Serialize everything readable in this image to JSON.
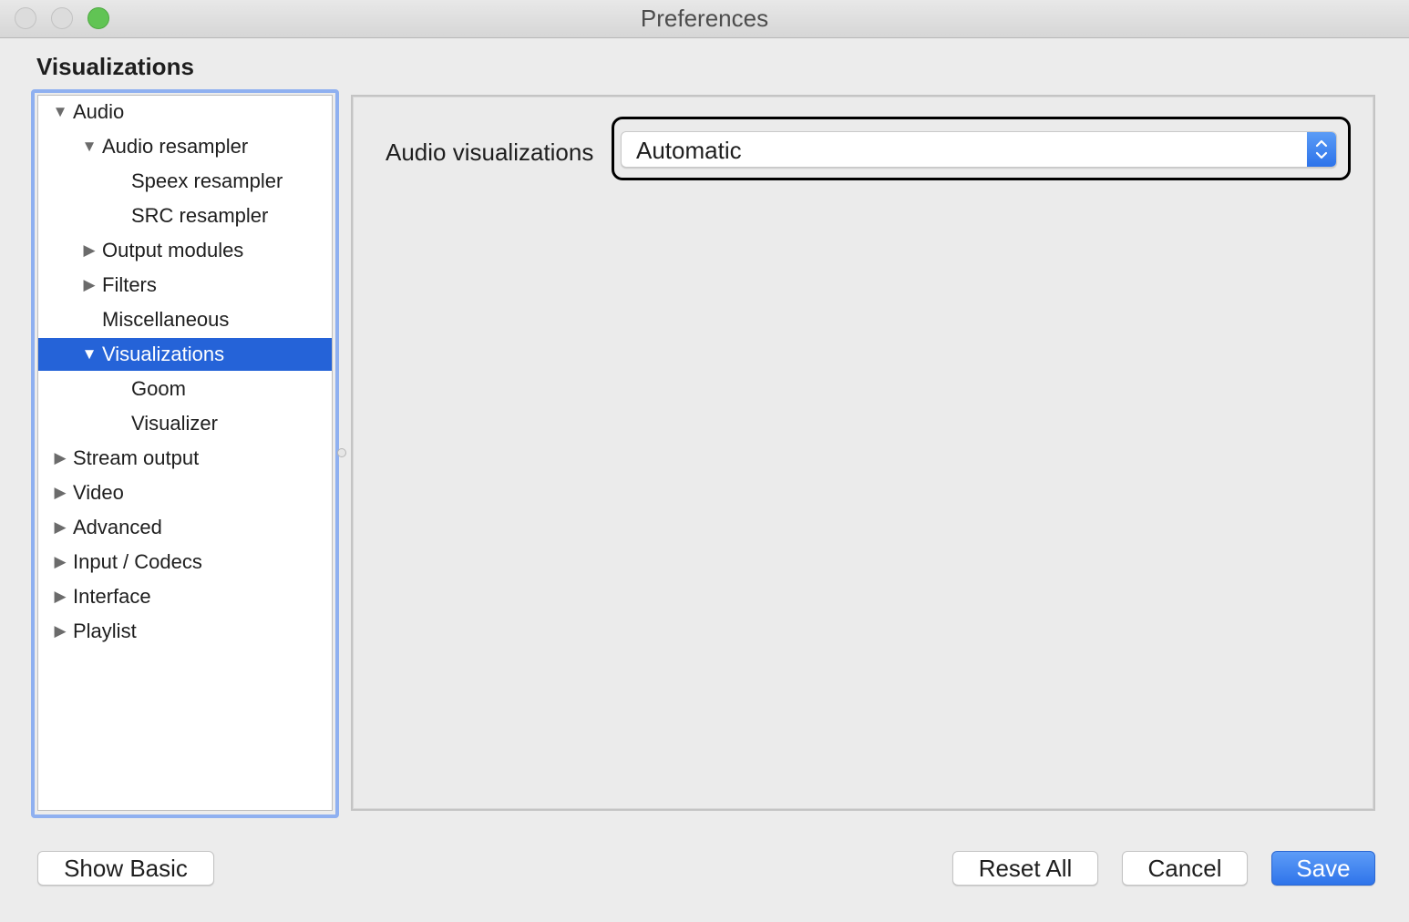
{
  "window": {
    "title": "Preferences"
  },
  "section_title": "Visualizations",
  "tree": {
    "items": [
      {
        "label": "Audio",
        "state": "expanded"
      },
      {
        "label": "Audio resampler",
        "state": "expanded"
      },
      {
        "label": "Speex resampler",
        "state": "leaf"
      },
      {
        "label": "SRC resampler",
        "state": "leaf"
      },
      {
        "label": "Output modules",
        "state": "collapsed"
      },
      {
        "label": "Filters",
        "state": "collapsed"
      },
      {
        "label": "Miscellaneous",
        "state": "leaf"
      },
      {
        "label": "Visualizations",
        "state": "expanded",
        "selected": true
      },
      {
        "label": "Goom",
        "state": "leaf"
      },
      {
        "label": "Visualizer",
        "state": "leaf"
      },
      {
        "label": "Stream output",
        "state": "collapsed"
      },
      {
        "label": "Video",
        "state": "collapsed"
      },
      {
        "label": "Advanced",
        "state": "collapsed"
      },
      {
        "label": "Input / Codecs",
        "state": "collapsed"
      },
      {
        "label": "Interface",
        "state": "collapsed"
      },
      {
        "label": "Playlist",
        "state": "collapsed"
      }
    ]
  },
  "settings": {
    "audio_visualizations_label": "Audio visualizations",
    "audio_visualizations_value": "Automatic"
  },
  "buttons": {
    "show_basic": "Show Basic",
    "reset_all": "Reset All",
    "cancel": "Cancel",
    "save": "Save"
  },
  "colors": {
    "selection": "#2563d8",
    "accent": "#2f74ea",
    "zoom_light": "#61c454",
    "focus_ring": "#8fb0f0"
  },
  "icons": {
    "expanded": "triangle-down-icon",
    "collapsed": "triangle-right-icon",
    "popup_stepper": "up-down-chevron-icon"
  }
}
